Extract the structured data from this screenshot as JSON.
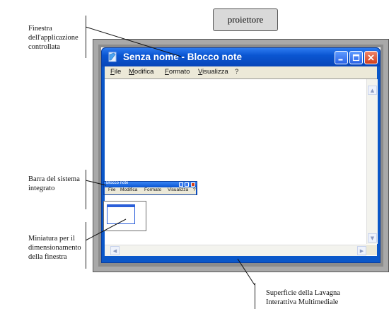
{
  "annotations": {
    "window": [
      "Finestra",
      "dell'applicazione",
      "controllata"
    ],
    "system_bar": [
      "Barra del sistema",
      "integrato"
    ],
    "thumbnail": [
      "Miniatura per il",
      "dimensionamento",
      "della finestra"
    ],
    "surface": [
      "Superficie della Lavagna",
      "Interattiva Multimediale"
    ]
  },
  "projector": {
    "label": "proiettore"
  },
  "notepad": {
    "title": "Senza nome - Blocco note",
    "menu": [
      "File",
      "Modifica",
      "Formato",
      "Visualizza",
      "?"
    ],
    "buttons": [
      "minimize-icon",
      "maximize-icon",
      "close-icon"
    ]
  },
  "system_bar": {
    "title": "Blocco note",
    "menu": [
      "File",
      "Modifica",
      "Formato",
      "Visualizza",
      "?"
    ]
  },
  "colors": {
    "titlebar": "#0a55d1",
    "close": "#d2401c",
    "menubar": "#ece9d8",
    "board_frame": "#a9a9a9",
    "projector": "#d9d9d9"
  }
}
